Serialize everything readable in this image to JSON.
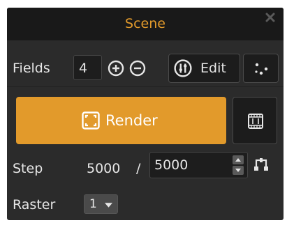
{
  "panel": {
    "title": "Scene",
    "close_icon": "close-icon"
  },
  "fields": {
    "label": "Fields",
    "value": "4",
    "add_icon": "plus-circle-icon",
    "remove_icon": "minus-circle-icon",
    "edit_label": "Edit",
    "edit_icon": "adjust-sliders-icon",
    "points_icon": "scatter-dots-icon"
  },
  "render": {
    "label": "Render",
    "icon": "frame-target-icon",
    "film_icon": "film-frame-icon"
  },
  "step": {
    "label": "Step",
    "current": "5000",
    "separator": "/",
    "total": "5000",
    "spin_icon": "spin-arrows-icon",
    "loop_icon": "link-nodes-icon"
  },
  "raster": {
    "label": "Raster",
    "value": "1",
    "dropdown_icon": "chevron-down-icon"
  },
  "colors": {
    "accent": "#e29a2b",
    "panel_bg": "#2b2b2b",
    "titlebar_bg": "#191919",
    "text": "#e6e6e6"
  }
}
